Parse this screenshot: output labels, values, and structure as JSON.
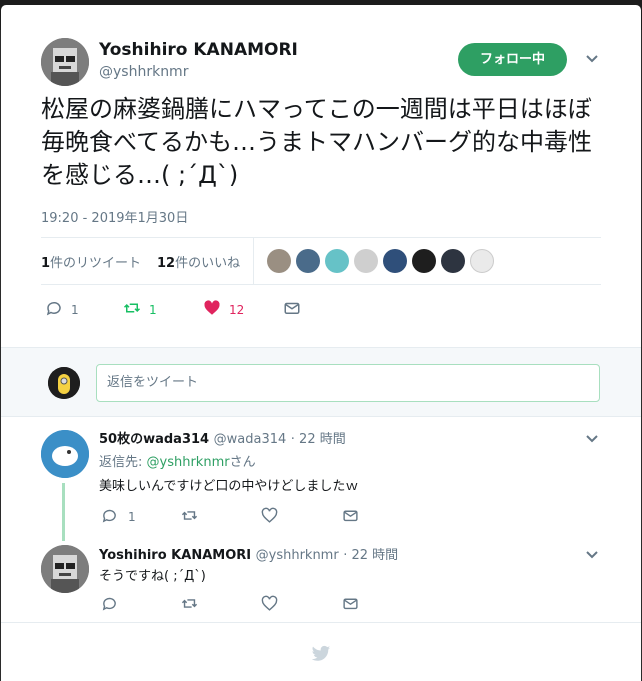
{
  "tweet": {
    "author_name": "Yoshihiro KANAMORI",
    "author_handle": "@yshhrknmr",
    "follow_label": "フォロー中",
    "text": "松屋の麻婆鍋膳にハマってこの一週間は平日はほぼ毎晩食べてるかも…うまトマハンバーグ的な中毒性を感じる…(  ;´Д`)",
    "timestamp": "19:20 - 2019年1月30日",
    "retweets_count": "1",
    "retweets_label": "件のリツイート",
    "likes_count": "12",
    "likes_label": "件のいいね",
    "action_reply_count": "1",
    "action_retweet_count": "1",
    "action_like_count": "12"
  },
  "reply_box": {
    "placeholder": "返信をツイート"
  },
  "replies": [
    {
      "name": "50枚のwada314",
      "handle": "@wada314",
      "age": "· 22 時間",
      "reply_to_prefix": "返信先: ",
      "reply_to_handle": "@yshhrknmr",
      "reply_to_suffix": "さん",
      "text": "美味しいんですけど口の中やけどしましたｗ",
      "reply_count": "1"
    },
    {
      "name": "Yoshihiro KANAMORI",
      "handle": "@yshhrknmr",
      "age": "· 22 時間",
      "text": "そうですね(  ;´Д`)"
    }
  ],
  "colors": {
    "accent": "#2e9f63",
    "like": "#e0245e",
    "muted": "#657786"
  },
  "icons": [
    "reply-icon",
    "retweet-icon",
    "heart-icon",
    "mail-icon",
    "chevron-down-icon",
    "twitter-bird-icon"
  ]
}
